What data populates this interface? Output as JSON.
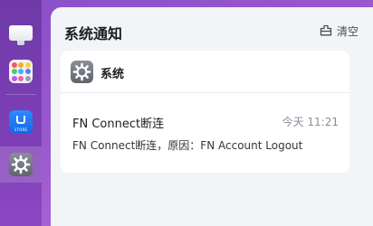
{
  "dock": {
    "store_label": "STORE",
    "grid_colors": [
      "#f15a5a",
      "#f7a928",
      "#f3d23a",
      "#4cc96a",
      "#37b6f0",
      "#5c7cf7",
      "#a665f2",
      "#ee62b6",
      "#9aa0aa"
    ],
    "active_item": "settings"
  },
  "panel": {
    "title": "系统通知",
    "clear_label": "清空"
  },
  "card": {
    "app_name": "系统",
    "notification": {
      "title": "FN Connect断连",
      "time": "今天 11:21",
      "body": "FN Connect断连，原因：FN Account Logout"
    }
  },
  "colors": {
    "background": "#9b59cf",
    "panel": "#f3f4f7",
    "card": "#ffffff",
    "store_blue": "#1567e8"
  }
}
